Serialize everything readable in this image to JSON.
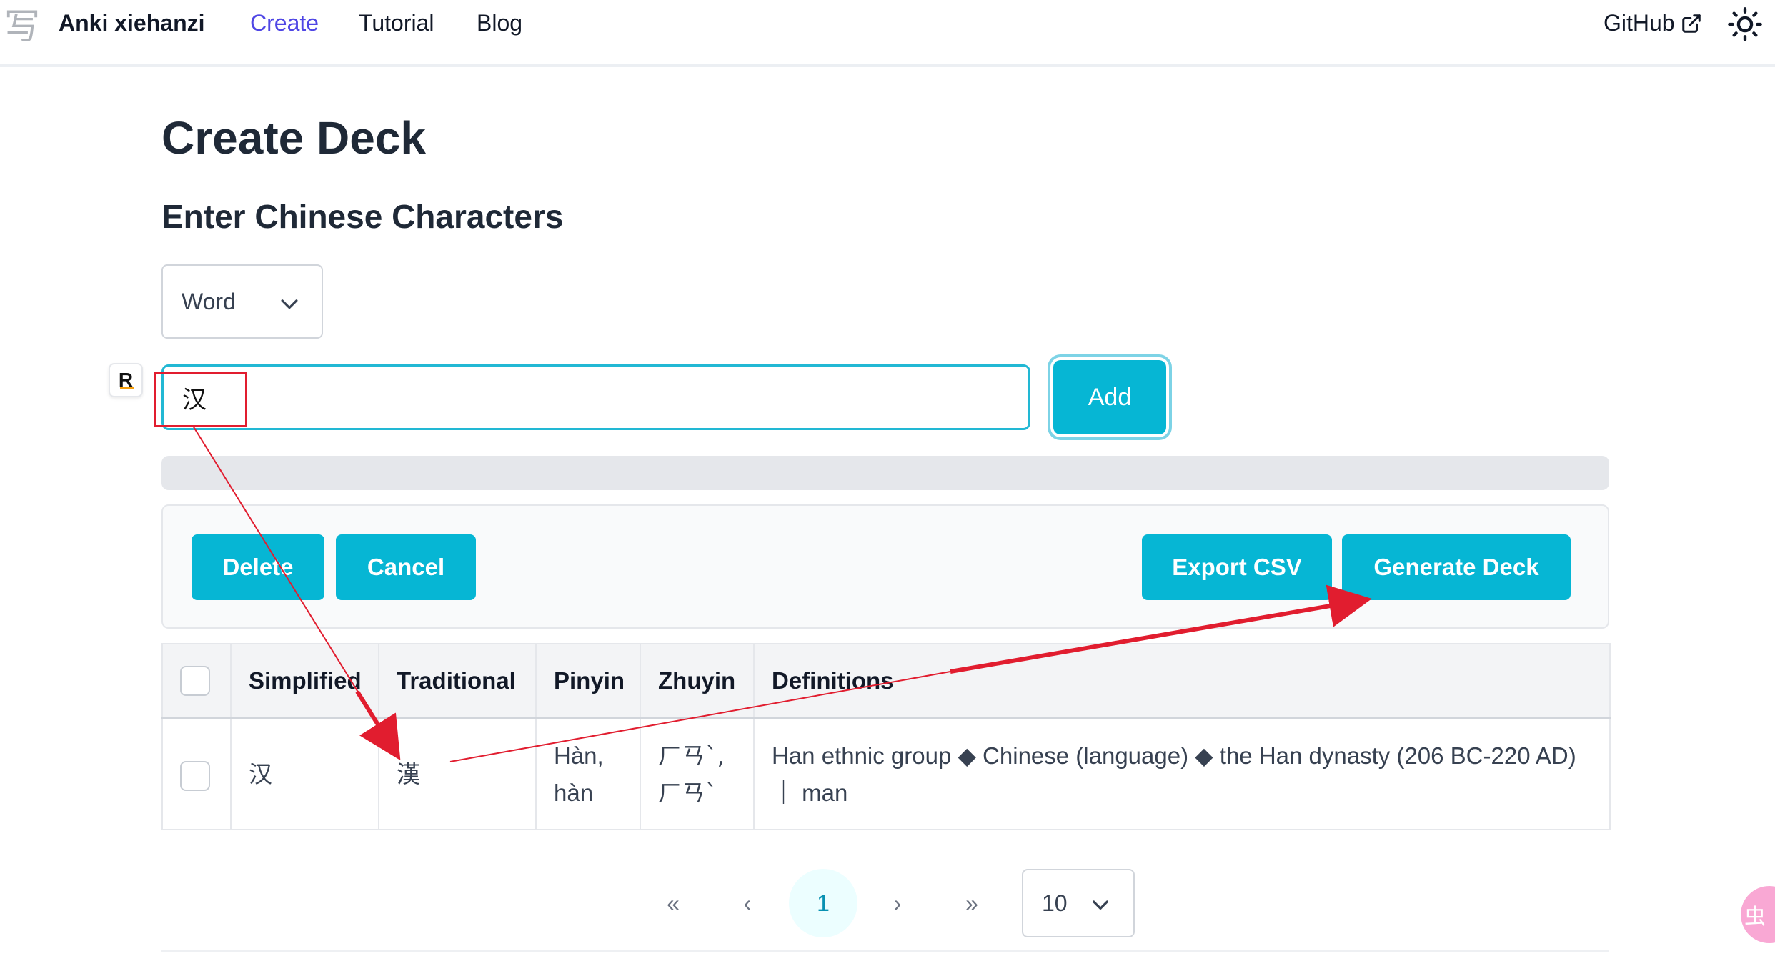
{
  "nav": {
    "logo_glyph": "写",
    "brand": "Anki xiehanzi",
    "links": {
      "create": "Create",
      "tutorial": "Tutorial",
      "blog": "Blog",
      "github": "GitHub"
    }
  },
  "page": {
    "title": "Create Deck",
    "section_title": "Enter Chinese Characters"
  },
  "form": {
    "mode": "Word",
    "input_value": "汉",
    "add_label": "Add",
    "extension_badge": "R"
  },
  "toolbar": {
    "delete_label": "Delete",
    "cancel_label": "Cancel",
    "export_label": "Export CSV",
    "generate_label": "Generate Deck"
  },
  "table": {
    "headers": {
      "simplified": "Simplified",
      "traditional": "Traditional",
      "pinyin": "Pinyin",
      "zhuyin": "Zhuyin",
      "definitions": "Definitions"
    },
    "rows": [
      {
        "checked": false,
        "simplified": "汉",
        "traditional": "漢",
        "pinyin": "Hàn, hàn",
        "zhuyin": "ㄏㄢˋ, ㄏㄢˋ",
        "definitions": "Han ethnic group ◆ Chinese (language) ◆ the Han dynasty (206 BC-220 AD) ｜ man"
      }
    ]
  },
  "pagination": {
    "first": "«",
    "prev": "‹",
    "current_page": "1",
    "next": "›",
    "last": "»",
    "page_size": "10"
  },
  "floating_button_glyph": "虫",
  "colors": {
    "accent": "#06b6d4",
    "nav_active": "#4f46e5",
    "annotation": "#e11d2f"
  }
}
